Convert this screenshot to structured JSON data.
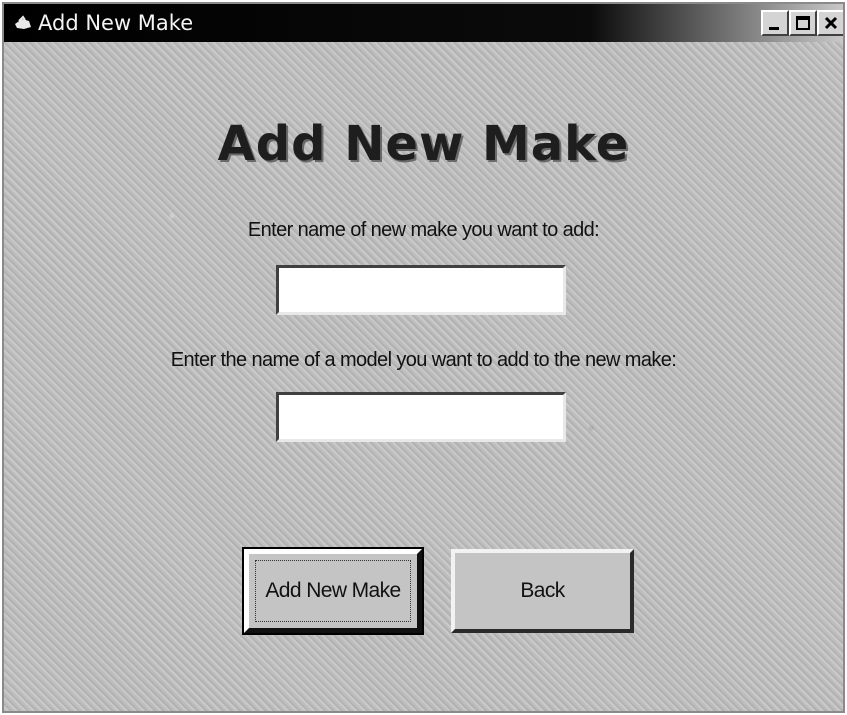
{
  "window": {
    "title": "Add New Make",
    "controls": [
      "minimize-icon",
      "maximize-icon",
      "close-icon"
    ]
  },
  "form": {
    "heading": "Add New Make",
    "make_label": "Enter name of new make you want to add:",
    "make_value": "",
    "model_label": "Enter the name of a model you want to add to the new make:",
    "model_value": ""
  },
  "buttons": {
    "add_label": "Add New Make",
    "back_label": "Back"
  }
}
